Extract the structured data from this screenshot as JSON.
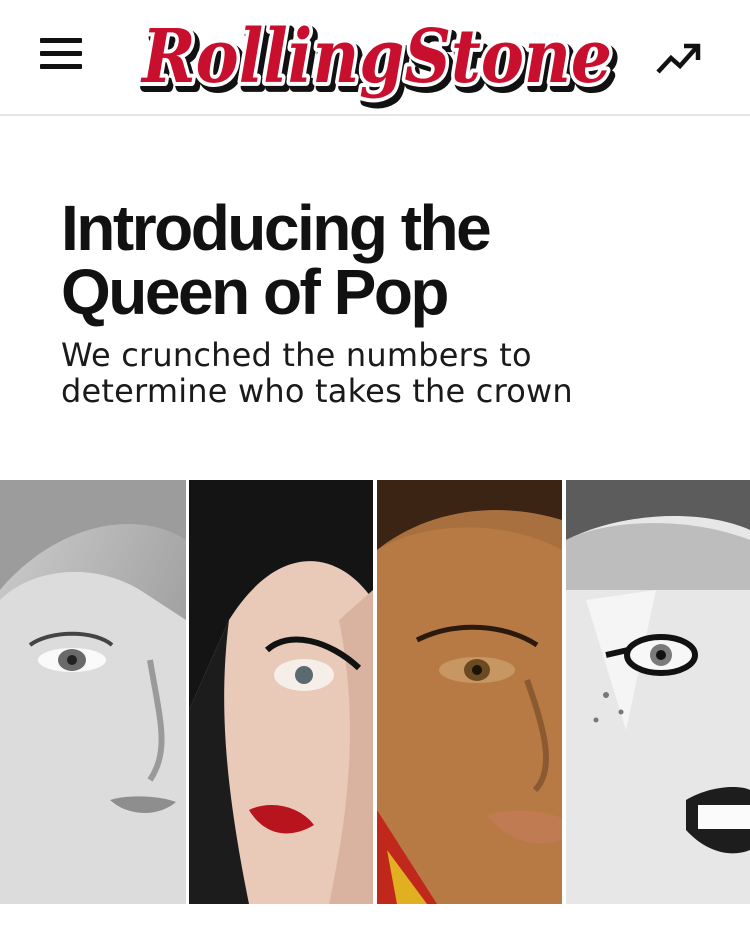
{
  "header": {
    "menu_icon": "hamburger-menu-icon",
    "logo_text": "RollingStone",
    "trending_icon": "trending-up-icon",
    "colors": {
      "logo_red": "#c8102e",
      "logo_shadow": "#111111",
      "background": "#ffffff",
      "divider": "#e6e6e6"
    }
  },
  "article": {
    "headline_line1": "Introducing the",
    "headline_line2": "Queen of Pop",
    "subhead_line1": "We crunched the numbers to",
    "subhead_line2": "determine who takes the crown"
  },
  "hero": {
    "panels": [
      {
        "tone": "black-and-white"
      },
      {
        "tone": "color"
      },
      {
        "tone": "color"
      },
      {
        "tone": "black-and-white"
      }
    ]
  }
}
